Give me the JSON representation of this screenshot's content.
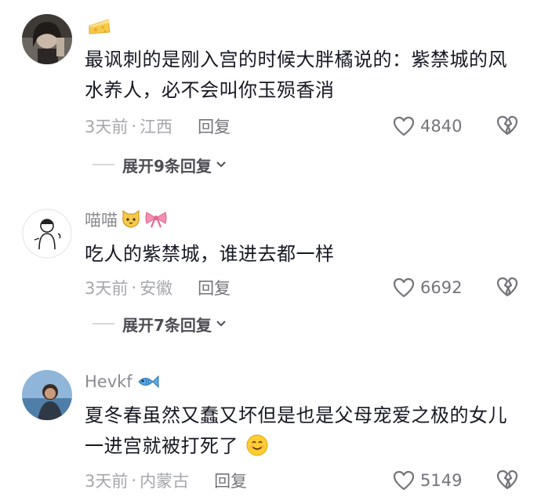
{
  "comments": [
    {
      "username": "",
      "badge_icon": "cheese-icon",
      "text": "最讽刺的是刚入宫的时候大胖橘说的：紫禁城的风水养人，必不会叫你玉殒香消",
      "time": "3天前",
      "location": "江西",
      "reply_label": "回复",
      "likes": "4840",
      "expand_label": "展开9条回复"
    },
    {
      "username": "喵喵",
      "badge_icon": "cat-face-icon",
      "badge_icon_2": "pink-bow-icon",
      "text": "吃人的紫禁城，谁进去都一样",
      "time": "3天前",
      "location": "安徽",
      "reply_label": "回复",
      "likes": "6692",
      "expand_label": "展开7条回复"
    },
    {
      "username": "Hevkf",
      "badge_icon": "fish-icon",
      "text": "夏冬春虽然又蠢又坏但是也是父母宠爱之极的女儿 一进宫就被打死了",
      "emoji_icon": "smiling-face-icon",
      "time": "3天前",
      "location": "内蒙古",
      "reply_label": "回复",
      "likes": "5149"
    }
  ],
  "meta_separator": "·",
  "colors": {
    "text": "#161823",
    "meta": "#a6a7ab",
    "username": "#8a8b91"
  }
}
